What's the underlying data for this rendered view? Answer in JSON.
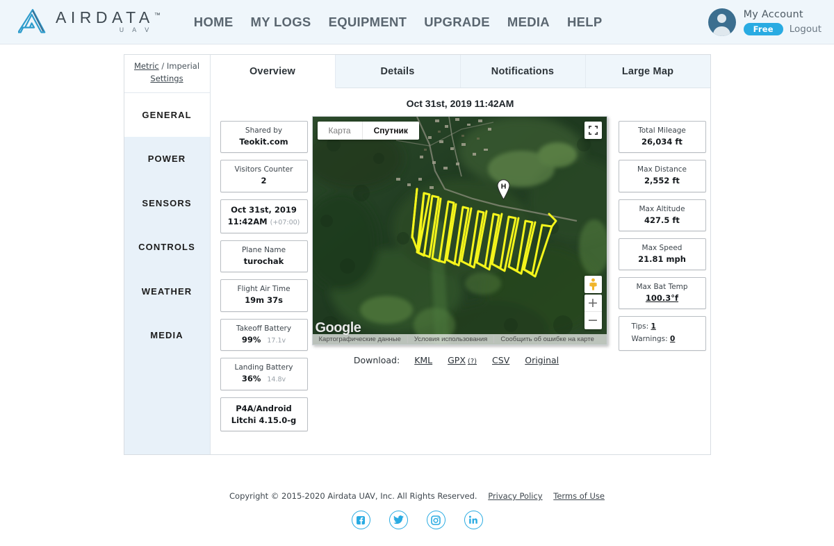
{
  "header": {
    "brand": {
      "name": "AIRDATA",
      "tm": "™",
      "sub": "U A V",
      "logo_icon": "airdata-triangle-logo"
    },
    "nav": [
      {
        "label": "HOME",
        "name": "nav-home"
      },
      {
        "label": "MY LOGS",
        "name": "nav-my-logs"
      },
      {
        "label": "EQUIPMENT",
        "name": "nav-equipment"
      },
      {
        "label": "UPGRADE",
        "name": "nav-upgrade"
      },
      {
        "label": "MEDIA",
        "name": "nav-media"
      },
      {
        "label": "HELP",
        "name": "nav-help"
      }
    ],
    "account": {
      "name_label": "My Account",
      "plan_badge": "Free",
      "logout_label": "Logout",
      "avatar_icon": "user-avatar-icon",
      "badge_color": "#29abe2"
    }
  },
  "sidebar": {
    "units": {
      "metric": "Metric",
      "separator": " / ",
      "imperial": "Imperial",
      "settings": "Settings"
    },
    "items": [
      {
        "label": "GENERAL",
        "active": true
      },
      {
        "label": "POWER",
        "active": false
      },
      {
        "label": "SENSORS",
        "active": false
      },
      {
        "label": "CONTROLS",
        "active": false
      },
      {
        "label": "WEATHER",
        "active": false
      },
      {
        "label": "MEDIA",
        "active": false
      }
    ]
  },
  "tabs": [
    {
      "label": "Overview",
      "active": true
    },
    {
      "label": "Details",
      "active": false
    },
    {
      "label": "Notifications",
      "active": false
    },
    {
      "label": "Large Map",
      "active": false
    }
  ],
  "flight": {
    "date_heading": "Oct 31st, 2019 11:42AM"
  },
  "left_cards": [
    {
      "label": "Shared by",
      "value": "Teokit.com",
      "sub": ""
    },
    {
      "label": "Visitors Counter",
      "value": "2",
      "sub": ""
    },
    {
      "label": "Oct 31st, 2019",
      "value": "11:42AM",
      "sub": "(+07:00)",
      "style": "date"
    },
    {
      "label": "Plane Name",
      "value": "turochak",
      "sub": ""
    },
    {
      "label": "Flight Air Time",
      "value": "19m 37s",
      "sub": ""
    },
    {
      "label": "Takeoff Battery",
      "value": "99%",
      "sub": "17.1v"
    },
    {
      "label": "Landing Battery",
      "value": "36%",
      "sub": "14.8v"
    },
    {
      "label": "P4A/Android",
      "value": "Litchi 4.15.0-g",
      "sub": "",
      "style": "bold-both"
    }
  ],
  "right_cards": [
    {
      "label": "Total Mileage",
      "value": "26,034 ft",
      "underline": false
    },
    {
      "label": "Max Distance",
      "value": "2,552 ft",
      "underline": false
    },
    {
      "label": "Max Altitude",
      "value": "427.5 ft",
      "underline": false
    },
    {
      "label": "Max Speed",
      "value": "21.81 mph",
      "underline": false
    },
    {
      "label": "Max Bat Temp",
      "value": "100.3°f",
      "underline": true
    }
  ],
  "notices": {
    "tips_label": "Tips:",
    "tips_value": "1",
    "warnings_label": "Warnings:",
    "warnings_value": "0"
  },
  "map": {
    "type_buttons": [
      {
        "label": "Карта",
        "active": false
      },
      {
        "label": "Спутник",
        "active": true
      }
    ],
    "fullscreen_icon": "fullscreen-icon",
    "pegman_icon": "street-view-pegman-icon",
    "zoom_in_label": "+",
    "zoom_out_label": "−",
    "logo_text": "Google",
    "attribution": [
      "Картографические данные",
      "Условия использования",
      "Сообщить об ошибке на карте"
    ],
    "home_marker_label": "H",
    "path_color": "#f5f51b"
  },
  "download": {
    "label": "Download:",
    "links": [
      {
        "label": "KML",
        "hint": ""
      },
      {
        "label": "GPX",
        "hint": "(?)"
      },
      {
        "label": "CSV",
        "hint": ""
      },
      {
        "label": "Original",
        "hint": ""
      }
    ]
  },
  "footer": {
    "copyright": "Copyright © 2015-2020 Airdata UAV, Inc. All Rights Reserved.",
    "privacy": "Privacy Policy",
    "terms": "Terms of Use",
    "social": [
      {
        "name": "facebook-icon",
        "glyph": "f"
      },
      {
        "name": "twitter-icon",
        "glyph": "t"
      },
      {
        "name": "instagram-icon",
        "glyph": "i"
      },
      {
        "name": "linkedin-icon",
        "glyph": "in"
      }
    ]
  }
}
